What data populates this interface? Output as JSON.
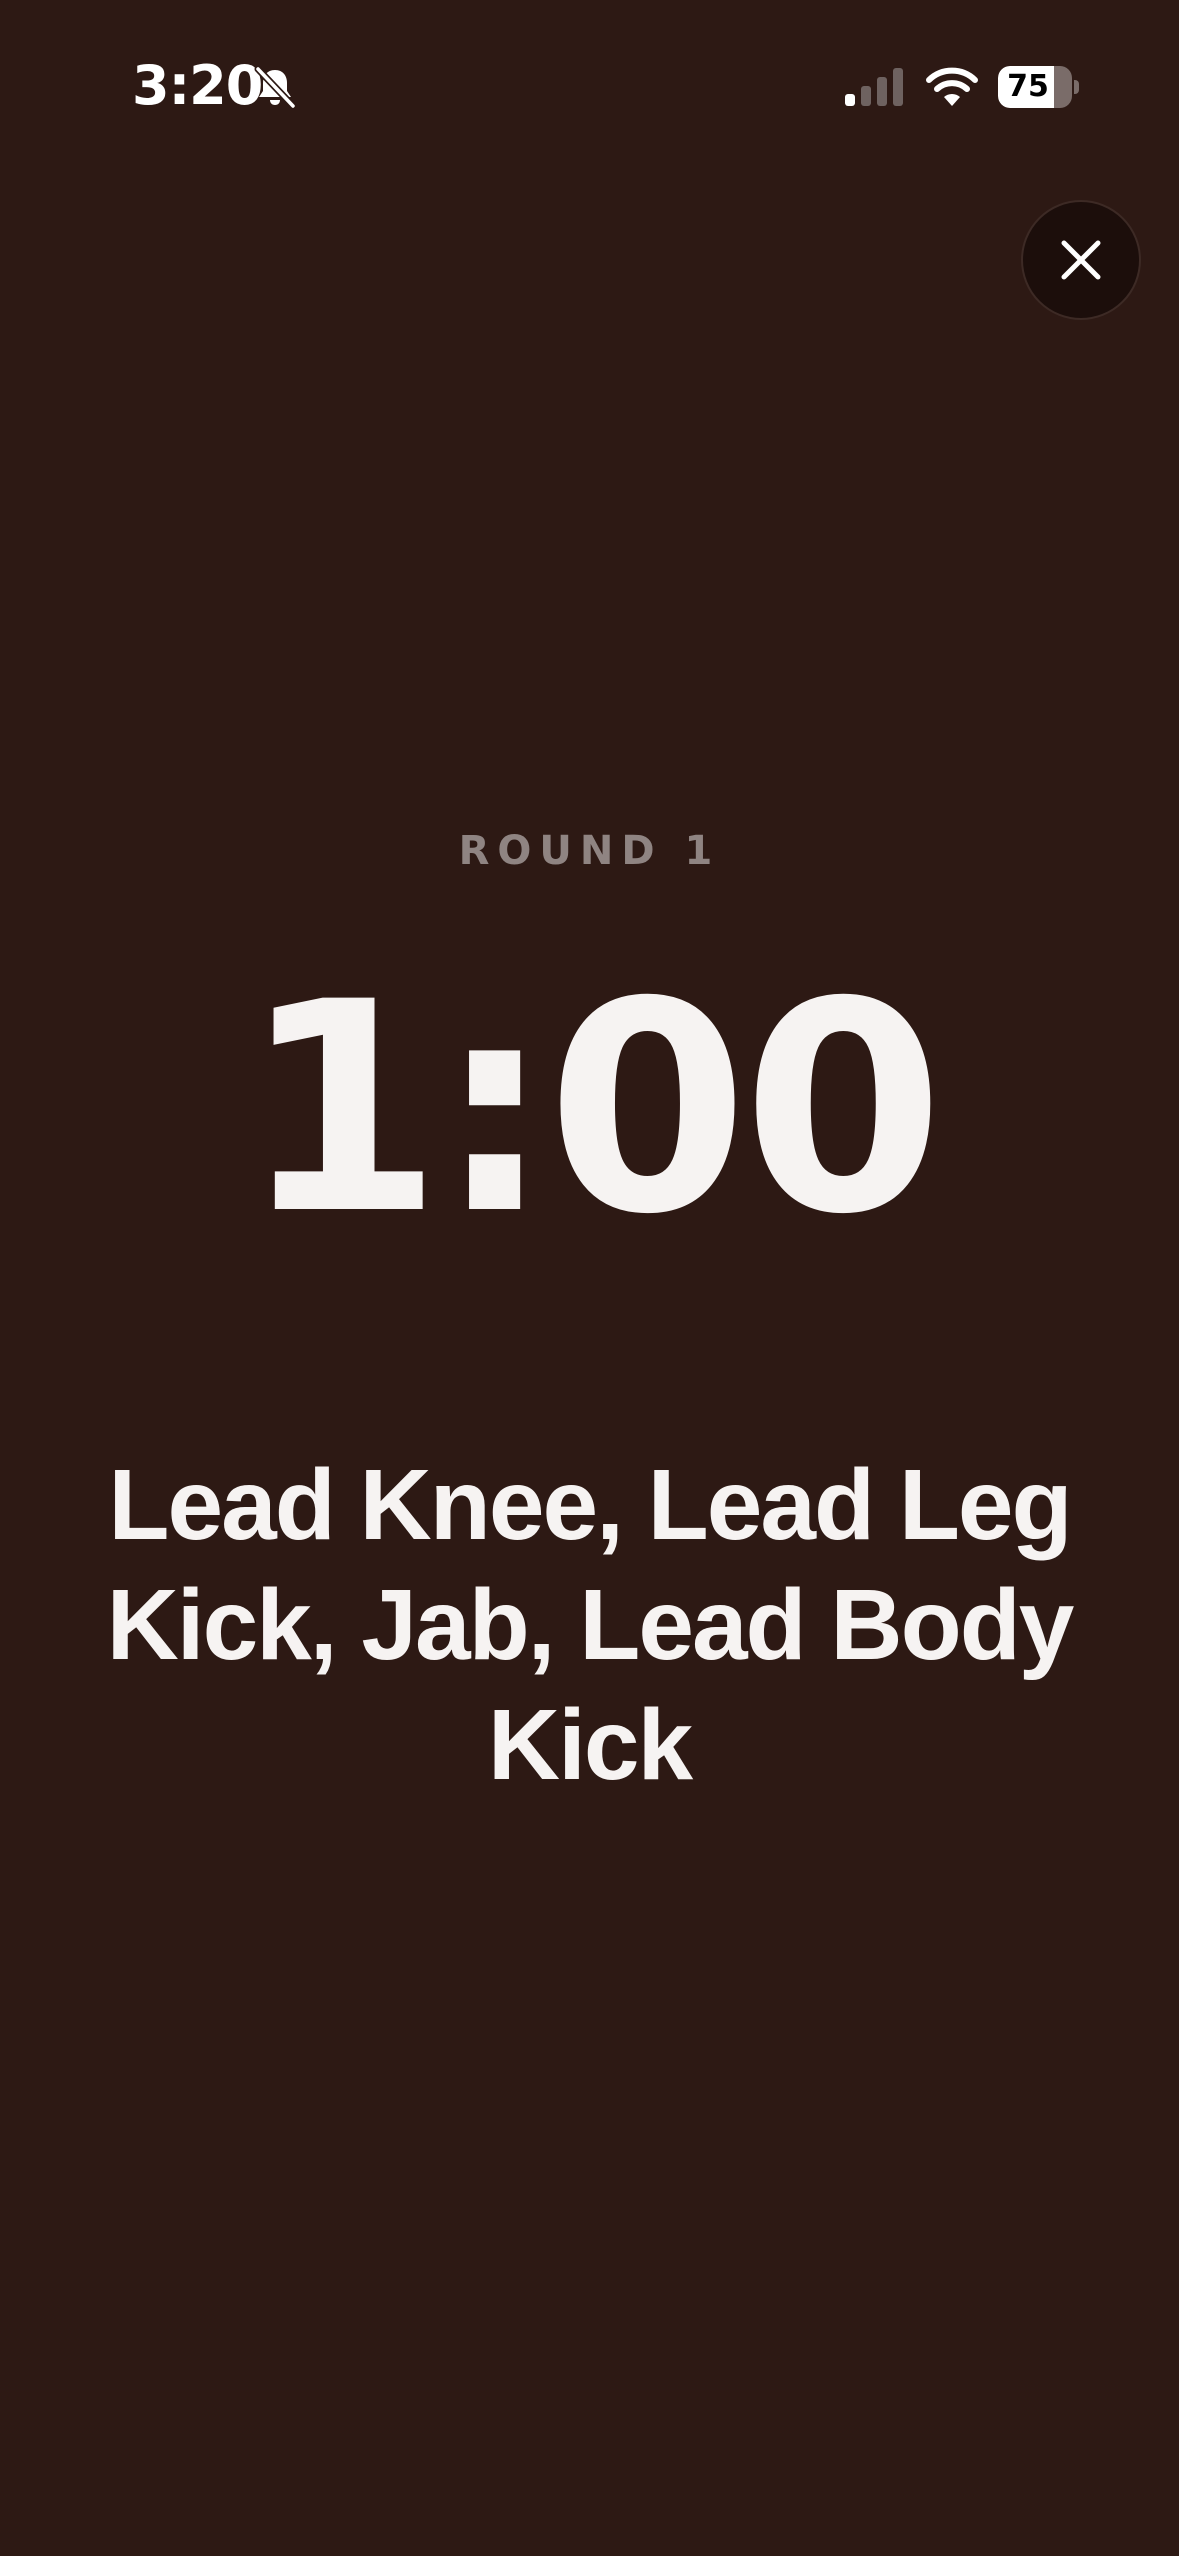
{
  "status_bar": {
    "time": "3:20",
    "battery_level": "75",
    "battery_fraction": 0.75,
    "icons": [
      "bell-off-icon",
      "signal-icon",
      "wifi-icon",
      "battery-icon"
    ]
  },
  "close_button": {
    "icon": "close-icon"
  },
  "session": {
    "round_label": "ROUND 1",
    "timer": "1:00",
    "combo": "Lead Knee, Lead Leg Kick, Jab, Lead Body Kick"
  },
  "colors": {
    "background": "#2d1914",
    "text": "#f6f3f2",
    "round_label": "#8f8482",
    "close_button_bg": "#1c0e0b"
  }
}
